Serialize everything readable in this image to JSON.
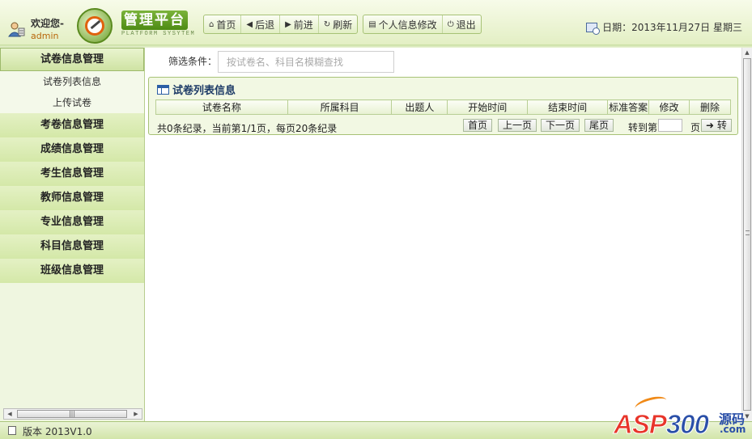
{
  "header": {
    "welcome": "欢迎您-",
    "username": "admin",
    "logo_title": "管理平台",
    "logo_subtitle": "PLATFORM SYSYTEM",
    "toolbar": {
      "home": "首页",
      "back": "后退",
      "forward": "前进",
      "refresh": "刷新",
      "profile": "个人信息修改",
      "logout": "退出"
    },
    "date": "日期：2013年11月27日 星期三"
  },
  "sidebar": {
    "active_section": "试卷信息管理",
    "sub_items": [
      "试卷列表信息",
      "上传试卷"
    ],
    "sections": [
      "考卷信息管理",
      "成绩信息管理",
      "考生信息管理",
      "教师信息管理",
      "专业信息管理",
      "科目信息管理",
      "班级信息管理"
    ]
  },
  "main": {
    "filter_label": "筛选条件：",
    "search_placeholder": "按试卷名、科目名模糊查找",
    "panel_title": "试卷列表信息",
    "columns": [
      "试卷名称",
      "所属科目",
      "出题人",
      "开始时间",
      "结束时间",
      "标准答案",
      "修改",
      "删除"
    ],
    "pager": {
      "summary": "共0条纪录，当前第1/1页，每页20条纪录",
      "first": "首页",
      "prev": "上一页",
      "next": "下一页",
      "last": "尾页",
      "goto_label": "转到第",
      "page_suffix": "页",
      "go": "转"
    }
  },
  "footer": {
    "version": "版本 2013V1.0"
  },
  "watermark": {
    "asp": "ASP",
    "num": "300",
    "cn": "源码",
    "com": ".com"
  }
}
